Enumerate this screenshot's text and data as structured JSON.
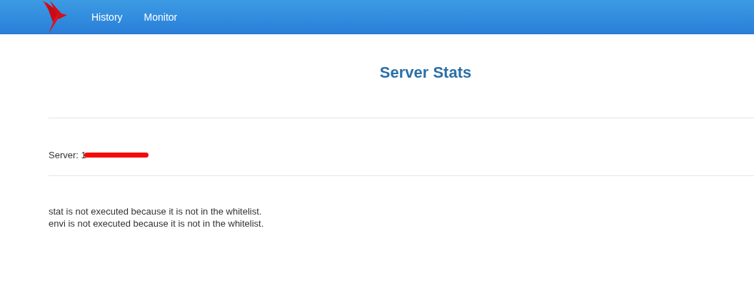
{
  "nav": {
    "links": [
      "History",
      "Monitor"
    ]
  },
  "title": "Server Stats",
  "server": {
    "label": "Server: 1",
    "redacted": true
  },
  "messages": [
    "stat is not executed because it is not in the whitelist.",
    "envi is not executed because it is not in the whitelist."
  ]
}
